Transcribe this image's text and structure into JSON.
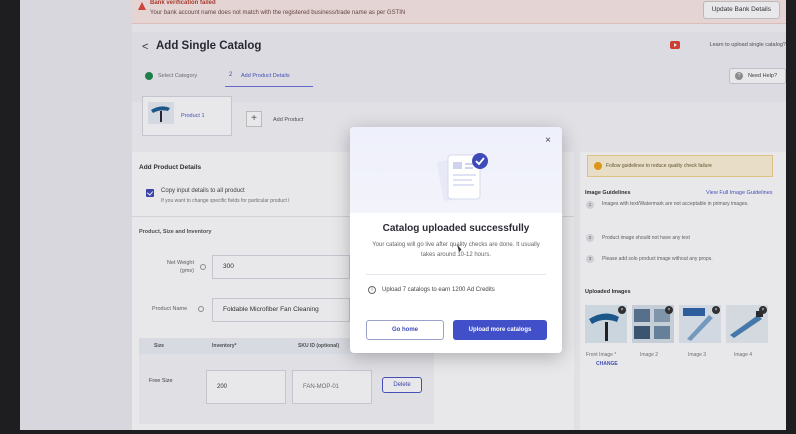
{
  "banner": {
    "title": "Bank verification failed",
    "message": "Your bank account name does not match with the registered business/trade name as per GSTIN",
    "button": "Update Bank Details"
  },
  "header": {
    "back": "<",
    "title": "Add Single Catalog",
    "learn": "Learn to upload single catalog?",
    "need_help": "Need Help?"
  },
  "steps": {
    "step1": "Select Category",
    "step2_num": "2",
    "step2": "Add Product Details"
  },
  "products": {
    "item": "Product 1",
    "add_label": "Add Product",
    "add_glyph": "+"
  },
  "form": {
    "section_title": "Add Product Details",
    "copy_title": "Copy input details to all product",
    "copy_sub": "If you want to change specific fields for particular product l",
    "section2": "Product, Size and Inventory",
    "net_weight_label_1": "Net Weight",
    "net_weight_label_2": "(gms)",
    "net_weight_value": "300",
    "product_name_label": "Product Name",
    "product_name_value": "Foldable Microfiber Fan Cleaning",
    "table_headers": [
      "Size",
      "Inventory*",
      "SKU ID (optional)"
    ],
    "size": "Free Size",
    "inventory": "200",
    "sku": "FAN-MOP-01",
    "delete": "Delete"
  },
  "right": {
    "tip": "Follow guidelines to reduce quality check failure",
    "guidelines_title": "Image Guidelines",
    "guidelines_link": "View Full Image Guidelines",
    "guidelines": [
      {
        "num": "1",
        "text": "Images with text/Watermark are not acceptable in primary images."
      },
      {
        "num": "2",
        "text": "Product image should not have any text"
      },
      {
        "num": "3",
        "text": "Please add solo product image without any props."
      }
    ],
    "uploaded_title": "Uploaded Images",
    "captions": [
      "Front Image *",
      "Image 2",
      "Image 3",
      "Image 4"
    ],
    "change": "CHANGE"
  },
  "modal": {
    "close": "×",
    "title": "Catalog uploaded successfully",
    "subtitle": "Your catalog will go live after quality checks are done. It usually takes around 10-12 hours.",
    "info_glyph": "i",
    "upload_hint": "Upload 7 catalogs to earn 1200 Ad Credits",
    "go_home": "Go home",
    "upload_more": "Upload more catalogs"
  }
}
